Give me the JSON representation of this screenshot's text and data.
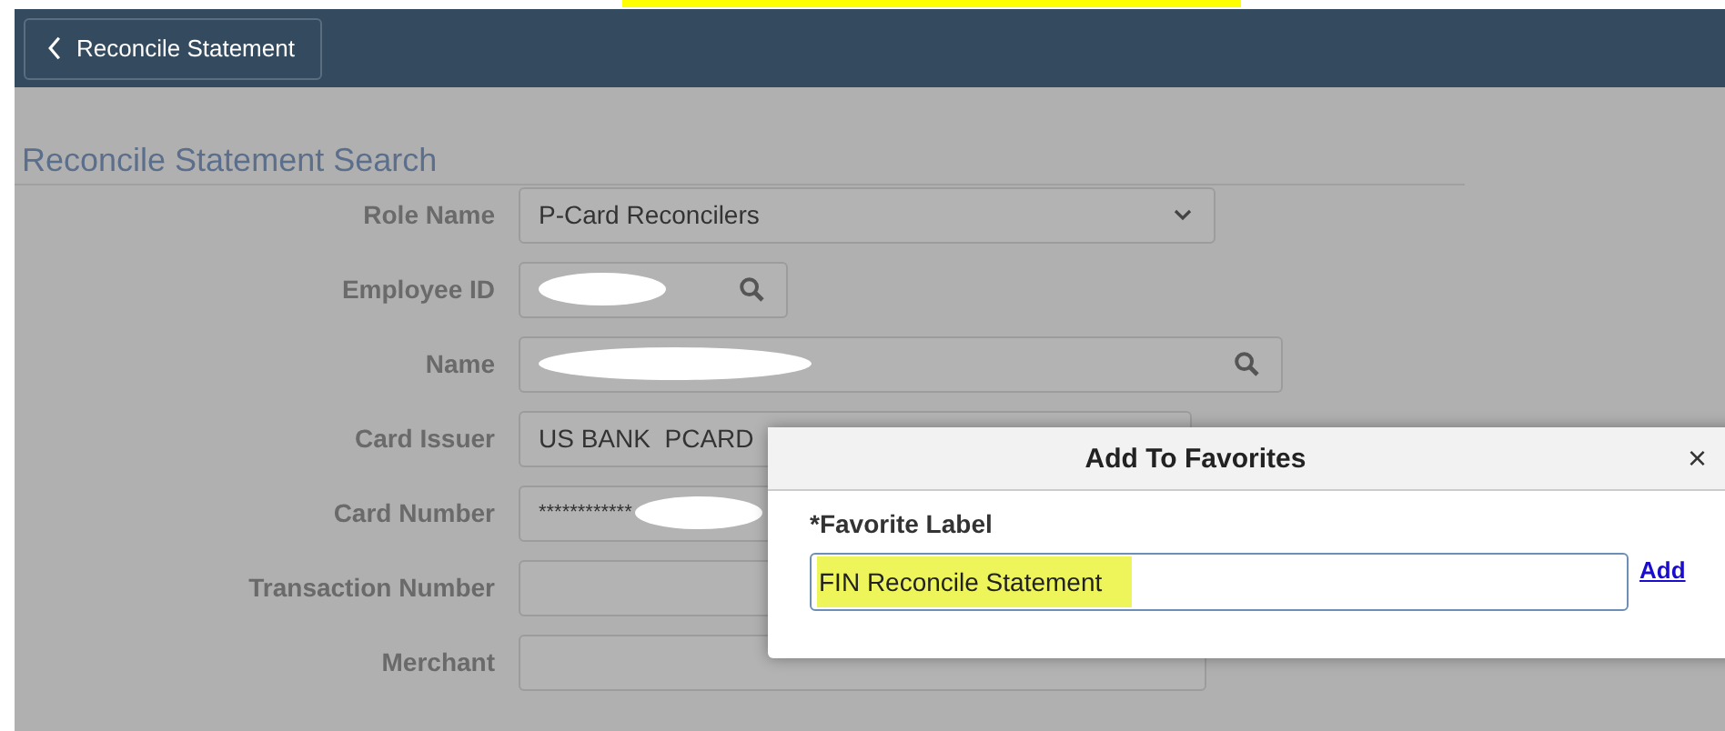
{
  "header": {
    "back_button": "Reconcile Statement"
  },
  "page": {
    "title": "Reconcile Statement Search"
  },
  "fields": [
    {
      "label": "Role Name",
      "kind": "select",
      "value": "P-Card Reconcilers",
      "redacted": false
    },
    {
      "label": "Employee ID",
      "kind": "lookup",
      "redacted": true
    },
    {
      "label": "Name",
      "kind": "lookup",
      "redacted": true
    },
    {
      "label": "Card Issuer",
      "kind": "text",
      "value": "US BANK  PCARD",
      "redacted": false
    },
    {
      "label": "Card Number",
      "kind": "text",
      "value": "************",
      "redacted": true
    },
    {
      "label": "Transaction Number",
      "kind": "text",
      "redacted": false
    },
    {
      "label": "Merchant",
      "kind": "text",
      "redacted": false
    }
  ],
  "dialog": {
    "title": "Add To Favorites",
    "close": "×",
    "field_label": "*Favorite Label",
    "value": "FIN Reconcile Statement",
    "action": "Add"
  }
}
